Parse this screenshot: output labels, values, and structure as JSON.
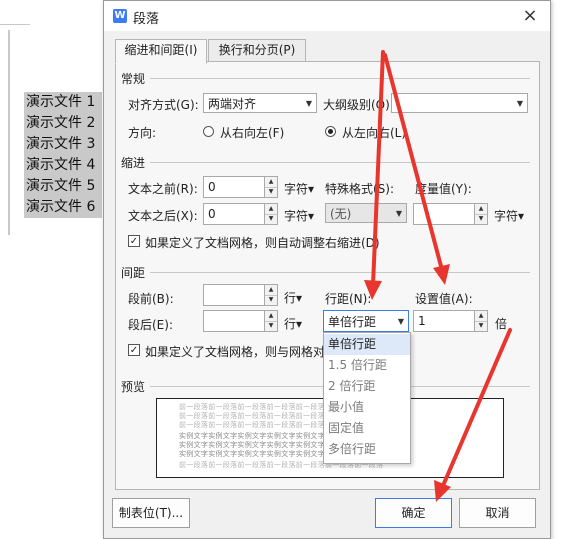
{
  "document": {
    "lines": [
      "演示文件 1",
      "演示文件 2",
      "演示文件 3",
      "演示文件 4",
      "演示文件 5",
      "演示文件 6"
    ]
  },
  "dialog": {
    "title": "段落",
    "icon": "wps-writer-icon",
    "close_label": "×",
    "tabs": [
      {
        "label": "缩进和间距(I)",
        "active": true
      },
      {
        "label": "换行和分页(P)",
        "active": false
      }
    ]
  },
  "general": {
    "title": "常规",
    "alignment_label": "对齐方式(G):",
    "alignment_value": "两端对齐",
    "outline_label": "大纲级别(O):",
    "outline_value": "",
    "direction_label": "方向:",
    "rtl_label": "从右向左(F)",
    "ltr_label": "从左向右(L)",
    "direction_selected": "ltr"
  },
  "indent": {
    "title": "缩进",
    "before_label": "文本之前(R):",
    "before_value": "0",
    "before_unit": "字符▾",
    "after_label": "文本之后(X):",
    "after_value": "0",
    "after_unit": "字符▾",
    "special_label": "特殊格式(S):",
    "special_value": "(无)",
    "measure_label": "度量值(Y):",
    "measure_value": "",
    "measure_unit": "字符▾",
    "grid_checkbox_label": "如果定义了文档网格，则自动调整右缩进(D)",
    "grid_checked": true
  },
  "spacing": {
    "title": "间距",
    "before_label": "段前(B):",
    "before_value": "",
    "before_unit": "行▾",
    "after_label": "段后(E):",
    "after_value": "",
    "after_unit": "行▾",
    "line_spacing_label": "行距(N):",
    "line_spacing_value": "单倍行距",
    "set_value_label": "设置值(A):",
    "set_value": "1",
    "set_value_unit": "倍",
    "grid_checkbox_label": "如果定义了文档网格，则与网格对",
    "grid_checked": true,
    "options": [
      "单倍行距",
      "1.5 倍行距",
      "2 倍行距",
      "最小值",
      "固定值",
      "多倍行距"
    ],
    "selected_option": "单倍行距"
  },
  "preview": {
    "title": "预览",
    "prev_text": "前一段落前一段落前一段落前一段落前一段落前一段落前一段落",
    "sample_text": "实例文字实例文字实例文字实例文字实例文字实例文字实例文字"
  },
  "buttons": {
    "tabs_label": "制表位(T)...",
    "ok_label": "确定",
    "cancel_label": "取消"
  },
  "colors": {
    "arrow": "#e8362f",
    "accent": "#3b7de8"
  }
}
